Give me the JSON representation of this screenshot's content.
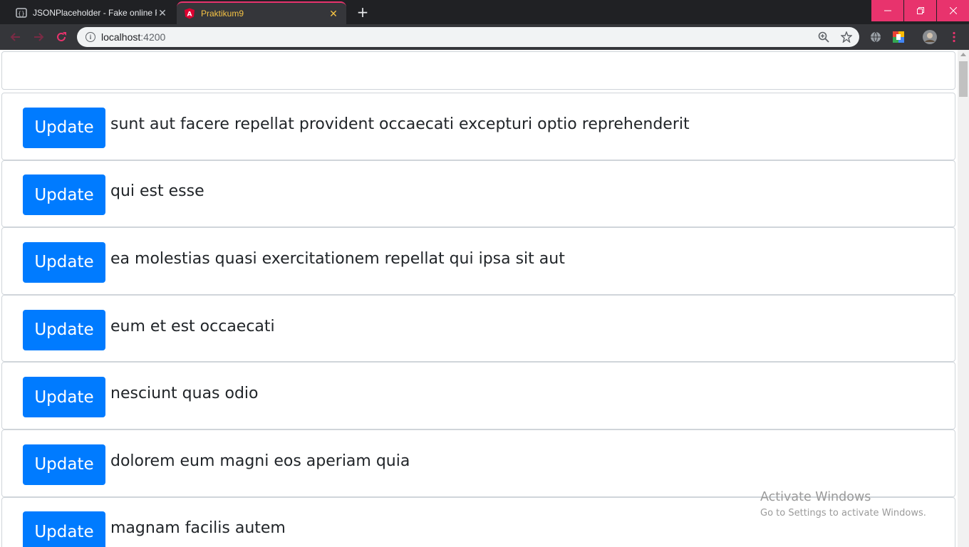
{
  "browser": {
    "tabs": [
      {
        "title": "JSONPlaceholder - Fake online REST API for developers",
        "favicon": "jsonplaceholder-icon",
        "active": false
      },
      {
        "title": "Praktikum9",
        "favicon": "angular-icon",
        "active": true
      }
    ],
    "new_tab_label": "+",
    "address_bar": {
      "host": "localhost",
      "port": ":4200"
    },
    "accent_color": "#e8336d"
  },
  "page": {
    "search_value": "",
    "update_label": "Update",
    "posts": [
      {
        "title": "sunt aut facere repellat provident occaecati excepturi optio reprehenderit"
      },
      {
        "title": "qui est esse"
      },
      {
        "title": "ea molestias quasi exercitationem repellat qui ipsa sit aut"
      },
      {
        "title": "eum et est occaecati"
      },
      {
        "title": "nesciunt quas odio"
      },
      {
        "title": "dolorem eum magni eos aperiam quia"
      },
      {
        "title": "magnam facilis autem"
      }
    ],
    "button_color": "#007bff"
  },
  "os_watermark": {
    "title": "Activate Windows",
    "subtitle": "Go to Settings to activate Windows."
  }
}
